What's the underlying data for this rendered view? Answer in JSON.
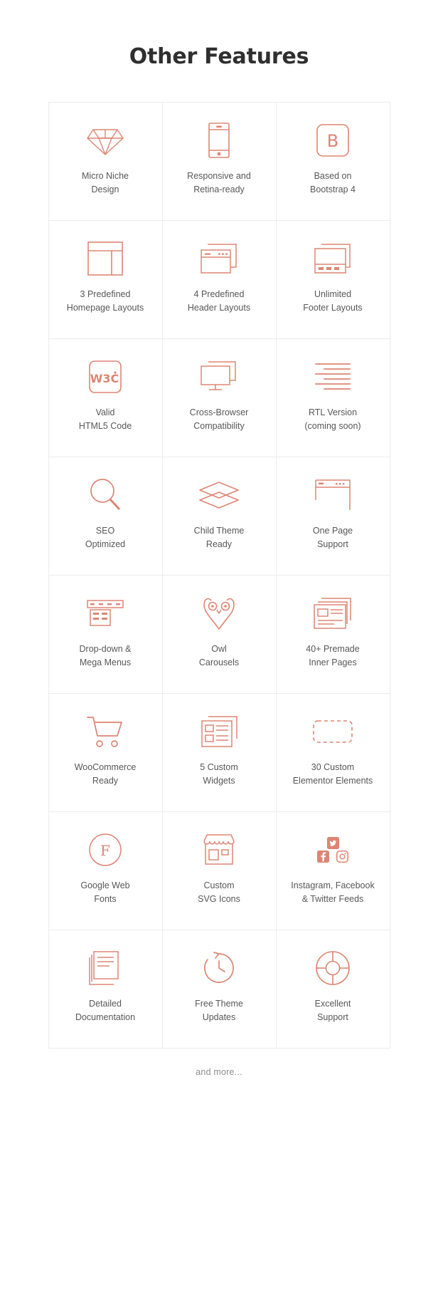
{
  "section": {
    "title": "Other Features",
    "footer_note": "and more...",
    "accent_color": "#dd8573",
    "text_color": "#575757",
    "title_color": "#2f2f2f",
    "border_color": "#ececec"
  },
  "features": [
    {
      "icon": "diamond-icon",
      "label": "Micro Niche\nDesign"
    },
    {
      "icon": "smartphone-icon",
      "label": "Responsive and\nRetina-ready"
    },
    {
      "icon": "bootstrap-b-icon",
      "label": "Based on\nBootstrap 4"
    },
    {
      "icon": "page-layout-icon",
      "label": "3 Predefined\nHomepage Layouts"
    },
    {
      "icon": "header-windows-icon",
      "label": "4 Predefined\nHeader Layouts"
    },
    {
      "icon": "footer-layout-icon",
      "label": "Unlimited\nFooter Layouts"
    },
    {
      "icon": "w3c-badge-icon",
      "label": "Valid\nHTML5 Code"
    },
    {
      "icon": "monitors-icon",
      "label": "Cross-Browser\nCompatibility"
    },
    {
      "icon": "rtl-lines-icon",
      "label": "RTL Version\n(coming soon)"
    },
    {
      "icon": "magnifier-icon",
      "label": "SEO\nOptimized"
    },
    {
      "icon": "layers-icon",
      "label": "Child Theme\nReady"
    },
    {
      "icon": "one-page-window-icon",
      "label": "One Page\nSupport"
    },
    {
      "icon": "dropdown-menu-icon",
      "label": "Drop-down &\nMega Menus"
    },
    {
      "icon": "owl-icon",
      "label": "Owl\nCarousels"
    },
    {
      "icon": "inner-pages-icon",
      "label": "40+ Premade\nInner Pages"
    },
    {
      "icon": "shopping-cart-icon",
      "label": "WooCommerce\nReady"
    },
    {
      "icon": "widgets-icon",
      "label": "5 Custom\nWidgets"
    },
    {
      "icon": "dashed-block-icon",
      "label": "30 Custom\nElementor Elements"
    },
    {
      "icon": "font-circle-f-icon",
      "label": "Google Web\nFonts"
    },
    {
      "icon": "storefront-icon",
      "label": "Custom\nSVG Icons"
    },
    {
      "icon": "social-feeds-icon",
      "label": "Instagram, Facebook\n& Twitter Feeds"
    },
    {
      "icon": "documentation-icon",
      "label": "Detailed\nDocumentation"
    },
    {
      "icon": "clock-refresh-icon",
      "label": "Free Theme\nUpdates"
    },
    {
      "icon": "lifebuoy-icon",
      "label": "Excellent\nSupport"
    }
  ]
}
